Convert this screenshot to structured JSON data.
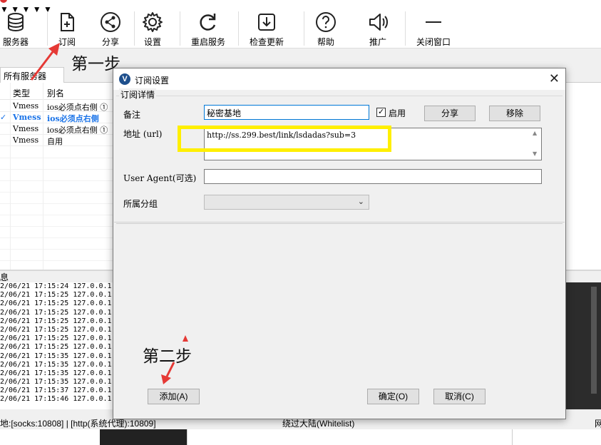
{
  "toolbar": {
    "servers": "服务器",
    "subscribe": "订阅",
    "share": "分享",
    "settings": "设置",
    "restart": "重启服务",
    "check_update": "检查更新",
    "help": "帮助",
    "promote": "推广",
    "close_window": "关闭窗口"
  },
  "server_tabs": {
    "all": "所有服务器"
  },
  "server_list": {
    "headers": {
      "type": "类型",
      "alias": "别名"
    },
    "rows": [
      {
        "type": "Vmess",
        "alias": "ios必须点右侧 ①"
      },
      {
        "type": "Vmess",
        "alias": "ios必须点右侧",
        "selected": true
      },
      {
        "type": "Vmess",
        "alias": "ios必须点右侧 ①"
      },
      {
        "type": "Vmess",
        "alias": "自用"
      }
    ]
  },
  "log": {
    "title": "息",
    "lines": [
      "2/06/21 17:15:24 127.0.0.1",
      "2/06/21 17:15:25 127.0.0.1",
      "2/06/21 17:15:25 127.0.0.1",
      "2/06/21 17:15:25 127.0.0.1",
      "2/06/21 17:15:25 127.0.0.1",
      "2/06/21 17:15:25 127.0.0.1",
      "2/06/21 17:15:25 127.0.0.1",
      "2/06/21 17:15:25 127.0.0.1",
      "2/06/21 17:15:35 127.0.0.1",
      "2/06/21 17:15:35 127.0.0.1",
      "2/06/21 17:15:35 127.0.0.1",
      "2/06/21 17:15:35 127.0.0.1",
      "2/06/21 17:15:37 127.0.0.1",
      "2/06/21 17:15:46 127.0.0.1"
    ]
  },
  "status_bar": {
    "proxy": "地:[socks:10808] | [http(系统代理):10809]",
    "routing": "绕过大陆(Whitelist)",
    "right": "网"
  },
  "dialog": {
    "title": "订阅设置",
    "group_label": "订阅详情",
    "remarks_label": "备注",
    "remarks_value": "秘密基地",
    "enabled_label": "启用",
    "enabled": true,
    "share_button": "分享",
    "remove_button": "移除",
    "url_label": "地址 (url)",
    "url_value": "http://ss.299.best/link/lsdadas?sub=3",
    "user_agent_label": "User Agent(可选)",
    "user_agent_value": "",
    "group_select_label": "所属分组",
    "group_select_value": "",
    "add_button": "添加(A)",
    "ok_button": "确定(O)",
    "cancel_button": "取消(C)"
  },
  "annotations": {
    "step1": "第一步",
    "step2": "第二步",
    "highlight_color": "#ffef00",
    "arrow_color": "#e53935"
  },
  "colors": {
    "selected_row_text": "#1a73e8",
    "dialog_title_icon": "#1e4f8c"
  }
}
